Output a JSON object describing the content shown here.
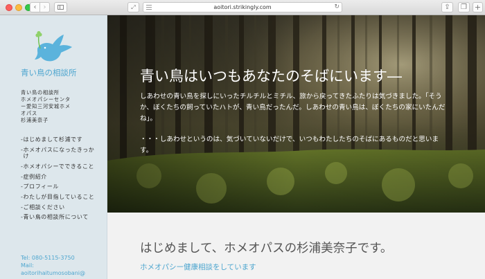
{
  "browser": {
    "url": "aoitori.strikingly.com",
    "back_glyph": "‹",
    "forward_glyph": "›",
    "expand_glyph": "⤢",
    "reload_glyph": "↻",
    "share_glyph": "⇪",
    "tabs_glyph": "❐",
    "newtab_glyph": "+"
  },
  "sidebar": {
    "site_title": "青い鳥の相談所",
    "org_lines": [
      "青い鳥の相談所",
      "ホメオパシーセンタ",
      "ー愛知三河安城ホメ",
      "オパス",
      "杉浦美奈子"
    ],
    "nav_items": [
      {
        "label": "はじめまして杉浦です"
      },
      {
        "label": "ホメオパスになったきっかけ"
      },
      {
        "label": "ホメオパシーでできること"
      },
      {
        "label": "症例紹介"
      },
      {
        "label": "プロフィール"
      },
      {
        "label": "わたしが目指していること"
      },
      {
        "label": "ご相談ください"
      },
      {
        "label": "青い鳥の相談所について"
      }
    ],
    "contact": {
      "tel": "Tel: 080-5115-3750",
      "mail_label": "Mail:",
      "mail": "aoitorihaitumosobani@"
    },
    "logo_color": "#5bb3dc"
  },
  "hero": {
    "title": "青い鳥はいつもあなたのそばにいます―",
    "paragraph1": "しあわせの青い鳥を探しにいったチルチルとミチル、旅から戻ってきたふたりは気づきました。「そうか、ぼくたちの飼っていたハトが、青い鳥だったんだ。しあわせの青い鳥は、ぼくたちの家にいたんだね」。",
    "paragraph2": "・・・しあわせというのは、気づいていないだけで、いつもわたしたちのそばにあるものだと思います。"
  },
  "section": {
    "title": "はじめまして、ホメオパスの杉浦美奈子です。",
    "subtitle": "ホメオパシー健康相談をしています"
  }
}
